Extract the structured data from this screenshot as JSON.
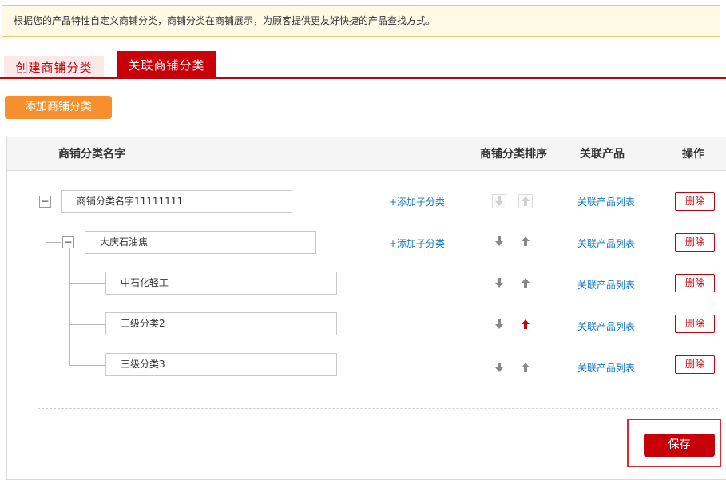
{
  "notice": "根据您的产品特性自定义商铺分类，商铺分类在商铺展示，为顾客提供更友好快捷的产品查找方式。",
  "tabs": [
    {
      "label": "创建商铺分类",
      "active": false
    },
    {
      "label": "关联商铺分类",
      "active": true
    }
  ],
  "add_button": "添加商铺分类",
  "table": {
    "headers": {
      "name": "商铺分类名字",
      "sort": "商铺分类排序",
      "products": "关联产品",
      "actions": "操作"
    },
    "rows": [
      {
        "name": "商铺分类名字11111111",
        "add_sub": "+添加子分类",
        "product_link": "关联产品列表",
        "delete": "删除",
        "toggle": "−"
      },
      {
        "name": "大庆石油焦",
        "add_sub": "+添加子分类",
        "product_link": "关联产品列表",
        "delete": "删除",
        "toggle": "−"
      },
      {
        "name": "中石化轻工",
        "product_link": "关联产品列表",
        "delete": "删除"
      },
      {
        "name": "三级分类2",
        "product_link": "关联产品列表",
        "delete": "删除"
      },
      {
        "name": "三级分类3",
        "product_link": "关联产品列表",
        "delete": "删除"
      }
    ]
  },
  "save_button": "保存",
  "colors": {
    "brand_red": "#c8000a",
    "orange": "#f5902c",
    "link_blue": "#1479c8",
    "arrow_gray": "#888888"
  },
  "icons": {
    "down": "arrow-down-icon",
    "up": "arrow-up-icon"
  }
}
